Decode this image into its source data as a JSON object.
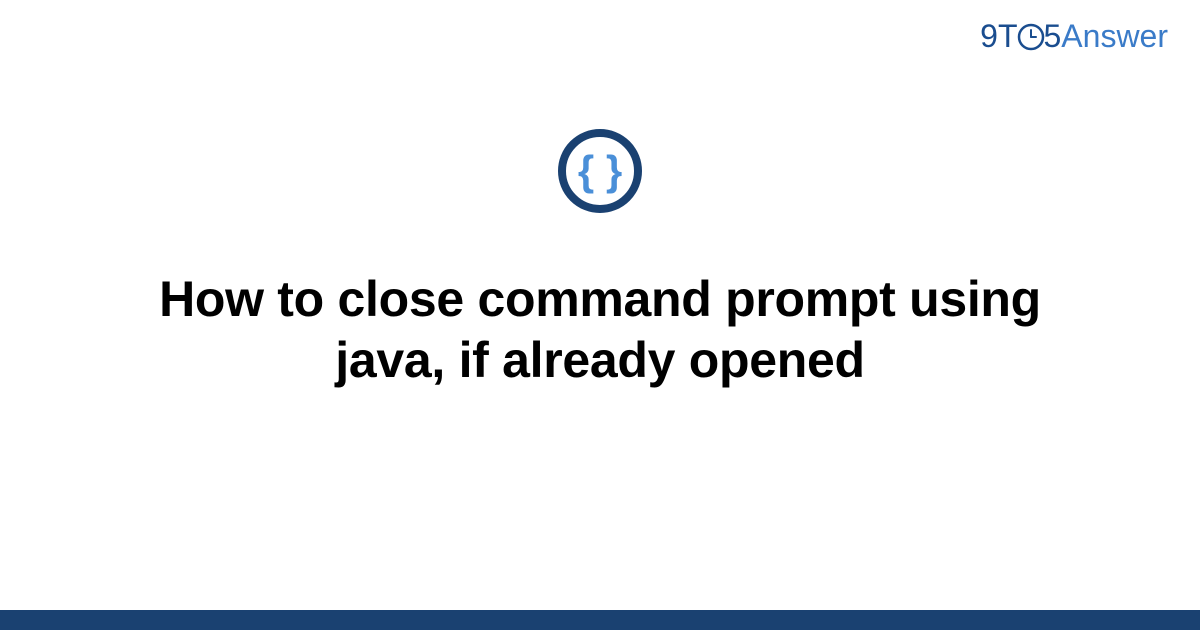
{
  "brand": {
    "part1": "9T",
    "part2": "5",
    "part3": "Answer"
  },
  "icon": {
    "name": "code-braces-icon",
    "glyph": "{ }"
  },
  "title": "How to close command prompt using java, if already opened",
  "colors": {
    "darkBlue": "#1a4d8f",
    "lightBlue": "#3a7bc8",
    "iconStroke": "#1a4171",
    "iconFill": "#4a8fd8",
    "footerBar": "#1a4171"
  }
}
